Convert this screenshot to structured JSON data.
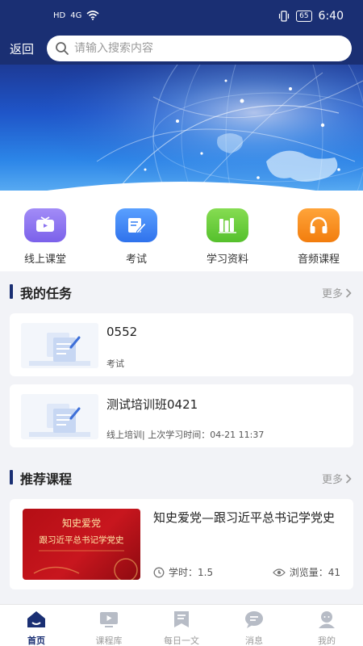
{
  "status_bar": {
    "left_indicators": [
      "HD",
      "4G"
    ],
    "battery": "65",
    "time": "6:40"
  },
  "top_bar": {
    "back_label": "返回",
    "search_placeholder": "请输入搜索内容"
  },
  "quick_nav": [
    {
      "label": "线上课堂",
      "icon": "tv-icon",
      "color": "#8f79f2"
    },
    {
      "label": "考试",
      "icon": "exam-edit-icon",
      "color": "#3d86f5"
    },
    {
      "label": "学习资料",
      "icon": "books-icon",
      "color": "#6ccf3e"
    },
    {
      "label": "音频课程",
      "icon": "headphones-icon",
      "color": "#f7931e"
    }
  ],
  "my_tasks": {
    "title": "我的任务",
    "more_label": "更多",
    "items": [
      {
        "title": "0552",
        "meta": "考试"
      },
      {
        "title": "测试培训班0421",
        "meta": "线上培训| 上次学习时间：04-21 11:37"
      }
    ]
  },
  "recommended": {
    "title": "推荐课程",
    "more_label": "更多",
    "course": {
      "title": "知史爱党—跟习近平总书记学党史",
      "hours": "学时：1.5",
      "views": "浏览量：41",
      "thumb_line1": "知史爱党",
      "thumb_line2": "跟习近平总书记学党史"
    }
  },
  "tab_bar": [
    {
      "label": "首页",
      "icon": "home-icon",
      "active": true
    },
    {
      "label": "课程库",
      "icon": "course-library-icon",
      "active": false
    },
    {
      "label": "每日一文",
      "icon": "daily-article-icon",
      "active": false
    },
    {
      "label": "消息",
      "icon": "message-icon",
      "active": false
    },
    {
      "label": "我的",
      "icon": "profile-icon",
      "active": false
    }
  ],
  "colors": {
    "header_bg": "#1a2f73",
    "accent": "#1a2f73",
    "page_bg": "#f2f3f7"
  }
}
